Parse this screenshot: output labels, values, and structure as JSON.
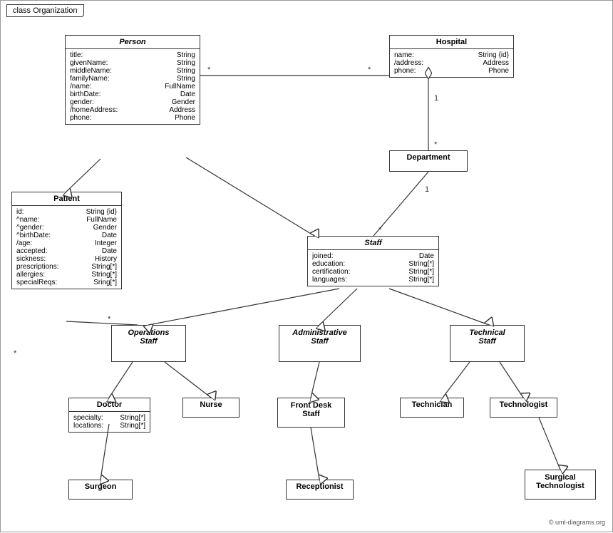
{
  "title": "class Organization",
  "classes": {
    "person": {
      "name": "Person",
      "italic": true,
      "attrs": [
        [
          "title:",
          "String"
        ],
        [
          "givenName:",
          "String"
        ],
        [
          "middleName:",
          "String"
        ],
        [
          "familyName:",
          "String"
        ],
        [
          "/name:",
          "FullName"
        ],
        [
          "birthDate:",
          "Date"
        ],
        [
          "gender:",
          "Gender"
        ],
        [
          "/homeAddress:",
          "Address"
        ],
        [
          "phone:",
          "Phone"
        ]
      ]
    },
    "hospital": {
      "name": "Hospital",
      "italic": false,
      "attrs": [
        [
          "name:",
          "String {id}"
        ],
        [
          "/address:",
          "Address"
        ],
        [
          "phone:",
          "Phone"
        ]
      ]
    },
    "patient": {
      "name": "Patient",
      "italic": false,
      "attrs": [
        [
          "id:",
          "String {id}"
        ],
        [
          "^name:",
          "FullName"
        ],
        [
          "^gender:",
          "Gender"
        ],
        [
          "^birthDate:",
          "Date"
        ],
        [
          "/age:",
          "Integer"
        ],
        [
          "accepted:",
          "Date"
        ],
        [
          "sickness:",
          "History"
        ],
        [
          "prescriptions:",
          "String[*]"
        ],
        [
          "allergies:",
          "String[*]"
        ],
        [
          "specialReqs:",
          "Sring[*]"
        ]
      ]
    },
    "department": {
      "name": "Department",
      "italic": false,
      "attrs": []
    },
    "staff": {
      "name": "Staff",
      "italic": true,
      "attrs": [
        [
          "joined:",
          "Date"
        ],
        [
          "education:",
          "String[*]"
        ],
        [
          "certification:",
          "String[*]"
        ],
        [
          "languages:",
          "String[*]"
        ]
      ]
    },
    "operations_staff": {
      "name": "Operations\nStaff",
      "italic": true,
      "attrs": []
    },
    "administrative_staff": {
      "name": "Administrative\nStaff",
      "italic": true,
      "attrs": []
    },
    "technical_staff": {
      "name": "Technical\nStaff",
      "italic": true,
      "attrs": []
    },
    "doctor": {
      "name": "Doctor",
      "italic": false,
      "attrs": [
        [
          "specialty:",
          "String[*]"
        ],
        [
          "locations:",
          "String[*]"
        ]
      ]
    },
    "nurse": {
      "name": "Nurse",
      "italic": false,
      "attrs": []
    },
    "front_desk_staff": {
      "name": "Front Desk\nStaff",
      "italic": false,
      "attrs": []
    },
    "technician": {
      "name": "Technician",
      "italic": false,
      "attrs": []
    },
    "technologist": {
      "name": "Technologist",
      "italic": false,
      "attrs": []
    },
    "surgeon": {
      "name": "Surgeon",
      "italic": false,
      "attrs": []
    },
    "receptionist": {
      "name": "Receptionist",
      "italic": false,
      "attrs": []
    },
    "surgical_technologist": {
      "name": "Surgical\nTechnologist",
      "italic": false,
      "attrs": []
    }
  },
  "copyright": "© uml-diagrams.org"
}
